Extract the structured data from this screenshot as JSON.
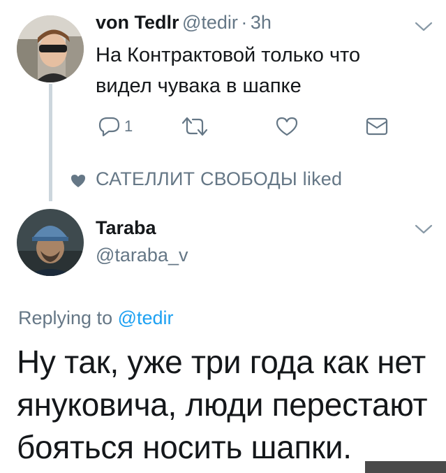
{
  "tweet1": {
    "name": "von Tedlr",
    "handle": "@tedir",
    "separator": "·",
    "time": "3h",
    "text_line1": "На Контрактовой только что",
    "text_line2": "видел чувака в шапке",
    "reply_count": "1",
    "icons": [
      "reply-icon",
      "retweet-icon",
      "like-icon",
      "dm-icon",
      "chevron-down-icon"
    ]
  },
  "liked_by": {
    "text": "САТЕЛЛИТ СВОБОДЫ liked"
  },
  "tweet2": {
    "name": "Taraba",
    "handle": "@taraba_v",
    "replying_prefix": "Replying to",
    "replying_to": "@tedir",
    "text_line1": "Ну так, уже три года как нет",
    "text_line2": "януковича, люди перестают",
    "text_line3": "бояться носить шапки."
  },
  "colors": {
    "text": "#14171a",
    "muted": "#657786",
    "link": "#1da1f2",
    "thread_line": "#ccd6dd"
  }
}
